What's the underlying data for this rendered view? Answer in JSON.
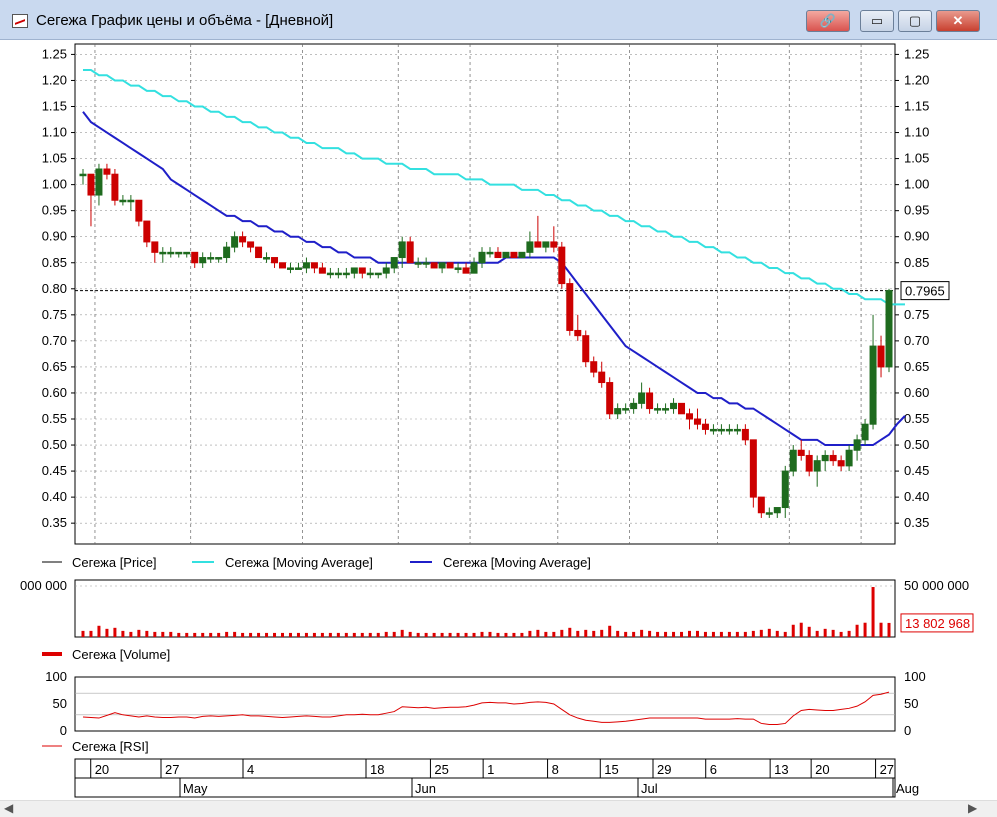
{
  "window": {
    "title": "Сегежа График цены и объёма - [Дневной]",
    "buttons": {
      "minimize": "▭",
      "maximize": "▢",
      "close": "✕",
      "link": "🔗"
    }
  },
  "colors": {
    "up_candle": "#1e6b1e",
    "down_candle": "#cc0000",
    "ma_long": "#33e0e0",
    "ma_short": "#1f1fc8",
    "volume": "#dd0000",
    "rsi": "#dd0000"
  },
  "legend": {
    "price": "Сегежа [Price]",
    "ma_long": "Сегежа [Moving Average]",
    "ma_short": "Сегежа [Moving Average]",
    "volume": "Сегежа [Volume]",
    "rsi": "Сегежа [RSI]"
  },
  "chart_data": [
    {
      "type": "candlestick",
      "name": "price",
      "ylim": [
        0.31,
        1.27
      ],
      "yticks": [
        "1.25",
        "1.20",
        "1.15",
        "1.10",
        "1.05",
        "1.00",
        "0.95",
        "0.90",
        "0.85",
        "0.80",
        "0.75",
        "0.70",
        "0.65",
        "0.60",
        "0.55",
        "0.50",
        "0.45",
        "0.40",
        "0.35"
      ],
      "last_price_label": "0.7965",
      "last_price": 0.7965,
      "grid": true,
      "candles": [
        [
          1.02,
          1.03,
          1.0,
          1.02
        ],
        [
          1.02,
          1.0,
          0.92,
          0.98
        ],
        [
          0.98,
          1.04,
          0.96,
          1.03
        ],
        [
          1.03,
          1.04,
          1.01,
          1.02
        ],
        [
          1.02,
          1.03,
          0.96,
          0.97
        ],
        [
          0.97,
          0.98,
          0.96,
          0.97
        ],
        [
          0.97,
          0.98,
          0.95,
          0.97
        ],
        [
          0.97,
          0.97,
          0.92,
          0.93
        ],
        [
          0.93,
          0.93,
          0.88,
          0.89
        ],
        [
          0.89,
          0.88,
          0.85,
          0.87
        ],
        [
          0.87,
          0.88,
          0.85,
          0.87
        ],
        [
          0.87,
          0.88,
          0.86,
          0.87
        ],
        [
          0.87,
          0.87,
          0.86,
          0.87
        ],
        [
          0.87,
          0.87,
          0.86,
          0.87
        ],
        [
          0.87,
          0.87,
          0.84,
          0.85
        ],
        [
          0.85,
          0.87,
          0.84,
          0.86
        ],
        [
          0.86,
          0.87,
          0.85,
          0.86
        ],
        [
          0.86,
          0.86,
          0.85,
          0.86
        ],
        [
          0.86,
          0.89,
          0.85,
          0.88
        ],
        [
          0.88,
          0.91,
          0.87,
          0.9
        ],
        [
          0.9,
          0.91,
          0.88,
          0.89
        ],
        [
          0.89,
          0.89,
          0.87,
          0.88
        ],
        [
          0.88,
          0.88,
          0.86,
          0.86
        ],
        [
          0.86,
          0.87,
          0.85,
          0.86
        ],
        [
          0.86,
          0.86,
          0.84,
          0.85
        ],
        [
          0.85,
          0.85,
          0.84,
          0.84
        ],
        [
          0.84,
          0.85,
          0.83,
          0.84
        ],
        [
          0.84,
          0.85,
          0.84,
          0.84
        ],
        [
          0.84,
          0.86,
          0.83,
          0.85
        ],
        [
          0.85,
          0.85,
          0.83,
          0.84
        ],
        [
          0.84,
          0.85,
          0.83,
          0.83
        ],
        [
          0.83,
          0.84,
          0.82,
          0.83
        ],
        [
          0.83,
          0.84,
          0.82,
          0.83
        ],
        [
          0.83,
          0.84,
          0.82,
          0.83
        ],
        [
          0.83,
          0.84,
          0.82,
          0.84
        ],
        [
          0.84,
          0.84,
          0.82,
          0.83
        ],
        [
          0.83,
          0.84,
          0.82,
          0.83
        ],
        [
          0.83,
          0.83,
          0.82,
          0.83
        ],
        [
          0.83,
          0.85,
          0.82,
          0.84
        ],
        [
          0.84,
          0.86,
          0.83,
          0.86
        ],
        [
          0.86,
          0.9,
          0.84,
          0.89
        ],
        [
          0.89,
          0.9,
          0.85,
          0.85
        ],
        [
          0.85,
          0.86,
          0.84,
          0.85
        ],
        [
          0.85,
          0.86,
          0.84,
          0.85
        ],
        [
          0.85,
          0.85,
          0.84,
          0.84
        ],
        [
          0.84,
          0.85,
          0.83,
          0.85
        ],
        [
          0.85,
          0.85,
          0.84,
          0.84
        ],
        [
          0.84,
          0.85,
          0.83,
          0.84
        ],
        [
          0.84,
          0.85,
          0.83,
          0.83
        ],
        [
          0.83,
          0.86,
          0.83,
          0.85
        ],
        [
          0.85,
          0.88,
          0.84,
          0.87
        ],
        [
          0.87,
          0.88,
          0.86,
          0.87
        ],
        [
          0.87,
          0.88,
          0.86,
          0.86
        ],
        [
          0.86,
          0.87,
          0.86,
          0.87
        ],
        [
          0.87,
          0.87,
          0.86,
          0.86
        ],
        [
          0.86,
          0.87,
          0.86,
          0.87
        ],
        [
          0.87,
          0.91,
          0.86,
          0.89
        ],
        [
          0.89,
          0.94,
          0.88,
          0.88
        ],
        [
          0.88,
          0.89,
          0.87,
          0.89
        ],
        [
          0.89,
          0.92,
          0.87,
          0.88
        ],
        [
          0.88,
          0.89,
          0.8,
          0.81
        ],
        [
          0.81,
          0.82,
          0.71,
          0.72
        ],
        [
          0.72,
          0.75,
          0.7,
          0.71
        ],
        [
          0.71,
          0.72,
          0.65,
          0.66
        ],
        [
          0.66,
          0.67,
          0.63,
          0.64
        ],
        [
          0.64,
          0.66,
          0.61,
          0.62
        ],
        [
          0.62,
          0.63,
          0.55,
          0.56
        ],
        [
          0.56,
          0.58,
          0.55,
          0.57
        ],
        [
          0.57,
          0.58,
          0.56,
          0.57
        ],
        [
          0.57,
          0.59,
          0.56,
          0.58
        ],
        [
          0.58,
          0.62,
          0.57,
          0.6
        ],
        [
          0.6,
          0.61,
          0.56,
          0.57
        ],
        [
          0.57,
          0.58,
          0.56,
          0.57
        ],
        [
          0.57,
          0.58,
          0.56,
          0.57
        ],
        [
          0.57,
          0.59,
          0.56,
          0.58
        ],
        [
          0.58,
          0.58,
          0.56,
          0.56
        ],
        [
          0.56,
          0.57,
          0.53,
          0.55
        ],
        [
          0.55,
          0.57,
          0.53,
          0.54
        ],
        [
          0.54,
          0.55,
          0.52,
          0.53
        ],
        [
          0.53,
          0.54,
          0.52,
          0.53
        ],
        [
          0.53,
          0.54,
          0.52,
          0.53
        ],
        [
          0.53,
          0.54,
          0.52,
          0.53
        ],
        [
          0.53,
          0.54,
          0.52,
          0.53
        ],
        [
          0.53,
          0.54,
          0.5,
          0.51
        ],
        [
          0.51,
          0.51,
          0.38,
          0.4
        ],
        [
          0.4,
          0.4,
          0.36,
          0.37
        ],
        [
          0.37,
          0.38,
          0.36,
          0.37
        ],
        [
          0.37,
          0.38,
          0.36,
          0.38
        ],
        [
          0.38,
          0.46,
          0.36,
          0.45
        ],
        [
          0.45,
          0.5,
          0.44,
          0.49
        ],
        [
          0.49,
          0.51,
          0.47,
          0.48
        ],
        [
          0.48,
          0.49,
          0.44,
          0.45
        ],
        [
          0.45,
          0.48,
          0.42,
          0.47
        ],
        [
          0.47,
          0.49,
          0.45,
          0.48
        ],
        [
          0.48,
          0.49,
          0.46,
          0.47
        ],
        [
          0.47,
          0.48,
          0.45,
          0.46
        ],
        [
          0.46,
          0.5,
          0.45,
          0.49
        ],
        [
          0.49,
          0.52,
          0.47,
          0.51
        ],
        [
          0.51,
          0.55,
          0.5,
          0.54
        ],
        [
          0.54,
          0.75,
          0.53,
          0.69
        ],
        [
          0.69,
          0.71,
          0.63,
          0.65
        ],
        [
          0.65,
          0.8,
          0.64,
          0.7965
        ]
      ],
      "ma_long": [
        1.22,
        1.22,
        1.21,
        1.21,
        1.2,
        1.2,
        1.19,
        1.19,
        1.18,
        1.18,
        1.17,
        1.17,
        1.16,
        1.16,
        1.15,
        1.15,
        1.14,
        1.14,
        1.13,
        1.13,
        1.12,
        1.12,
        1.11,
        1.11,
        1.1,
        1.1,
        1.09,
        1.09,
        1.08,
        1.08,
        1.07,
        1.07,
        1.07,
        1.06,
        1.06,
        1.05,
        1.05,
        1.05,
        1.04,
        1.04,
        1.04,
        1.03,
        1.03,
        1.03,
        1.02,
        1.02,
        1.02,
        1.02,
        1.01,
        1.01,
        1.01,
        1.0,
        1.0,
        1.0,
        1.0,
        0.99,
        0.99,
        0.99,
        0.98,
        0.98,
        0.97,
        0.97,
        0.96,
        0.96,
        0.95,
        0.95,
        0.94,
        0.94,
        0.93,
        0.93,
        0.92,
        0.92,
        0.91,
        0.91,
        0.9,
        0.9,
        0.89,
        0.89,
        0.88,
        0.88,
        0.87,
        0.87,
        0.86,
        0.86,
        0.85,
        0.85,
        0.84,
        0.84,
        0.83,
        0.83,
        0.82,
        0.82,
        0.81,
        0.81,
        0.8,
        0.8,
        0.79,
        0.79,
        0.78,
        0.78,
        0.78,
        0.77,
        0.77,
        0.77
      ],
      "ma_short": [
        1.14,
        1.12,
        1.11,
        1.1,
        1.09,
        1.08,
        1.07,
        1.06,
        1.05,
        1.04,
        1.03,
        1.01,
        1.0,
        0.99,
        0.98,
        0.97,
        0.96,
        0.95,
        0.94,
        0.94,
        0.93,
        0.93,
        0.92,
        0.92,
        0.91,
        0.91,
        0.9,
        0.9,
        0.89,
        0.89,
        0.88,
        0.88,
        0.87,
        0.87,
        0.86,
        0.86,
        0.86,
        0.85,
        0.85,
        0.85,
        0.85,
        0.85,
        0.85,
        0.85,
        0.85,
        0.85,
        0.85,
        0.85,
        0.85,
        0.85,
        0.85,
        0.85,
        0.85,
        0.86,
        0.86,
        0.86,
        0.86,
        0.86,
        0.86,
        0.86,
        0.85,
        0.83,
        0.81,
        0.79,
        0.77,
        0.75,
        0.73,
        0.71,
        0.69,
        0.68,
        0.67,
        0.66,
        0.65,
        0.64,
        0.63,
        0.62,
        0.61,
        0.6,
        0.6,
        0.59,
        0.59,
        0.58,
        0.58,
        0.57,
        0.57,
        0.56,
        0.55,
        0.54,
        0.53,
        0.52,
        0.51,
        0.51,
        0.51,
        0.5,
        0.5,
        0.5,
        0.5,
        0.5,
        0.5,
        0.5,
        0.51,
        0.52,
        0.54,
        0.556
      ]
    },
    {
      "type": "bar",
      "name": "volume",
      "ylim": [
        0,
        50000000
      ],
      "yticks_left": [
        "000 000"
      ],
      "yticks_right": [
        "50 000 000"
      ],
      "last_value_label": "13 802 968",
      "last_value": 13802968,
      "values": [
        6000000,
        6000000,
        11000000,
        8000000,
        9000000,
        6000000,
        5000000,
        7000000,
        6000000,
        5000000,
        5000000,
        5000000,
        4000000,
        4000000,
        4000000,
        4000000,
        4000000,
        4000000,
        5000000,
        5000000,
        4000000,
        4000000,
        4000000,
        4000000,
        4000000,
        4000000,
        4000000,
        4000000,
        4000000,
        4000000,
        4000000,
        4000000,
        4000000,
        4000000,
        4000000,
        4000000,
        4000000,
        4000000,
        5000000,
        5000000,
        7000000,
        5000000,
        4000000,
        4000000,
        4000000,
        4000000,
        4000000,
        4000000,
        4000000,
        4000000,
        5000000,
        5000000,
        4000000,
        4000000,
        4000000,
        4000000,
        6000000,
        7000000,
        5000000,
        5000000,
        7000000,
        9000000,
        6000000,
        7000000,
        6000000,
        7000000,
        11000000,
        6000000,
        5000000,
        5000000,
        7000000,
        6000000,
        5000000,
        5000000,
        5000000,
        5000000,
        6000000,
        6000000,
        5000000,
        5000000,
        5000000,
        5000000,
        5000000,
        5000000,
        6000000,
        7000000,
        8000000,
        6000000,
        5000000,
        12000000,
        14000000,
        10000000,
        6000000,
        8000000,
        7000000,
        5000000,
        6000000,
        12000000,
        14000000,
        49000000,
        14000000,
        13802968
      ]
    },
    {
      "type": "line",
      "name": "rsi",
      "ylim": [
        0,
        100
      ],
      "yticks": [
        "100",
        "50",
        "0"
      ],
      "values": [
        26,
        25,
        24,
        29,
        34,
        30,
        28,
        26,
        28,
        26,
        25,
        25,
        26,
        26,
        24,
        27,
        28,
        27,
        28,
        29,
        30,
        28,
        28,
        27,
        26,
        25,
        26,
        27,
        28,
        27,
        26,
        26,
        28,
        30,
        30,
        31,
        30,
        30,
        33,
        36,
        45,
        44,
        43,
        44,
        42,
        43,
        44,
        44,
        45,
        48,
        52,
        53,
        52,
        52,
        50,
        51,
        53,
        54,
        53,
        50,
        40,
        30,
        24,
        20,
        18,
        16,
        16,
        17,
        18,
        20,
        22,
        24,
        24,
        24,
        24,
        24,
        24,
        24,
        22,
        22,
        22,
        22,
        23,
        22,
        22,
        14,
        12,
        12,
        14,
        28,
        38,
        40,
        39,
        38,
        38,
        40,
        42,
        46,
        54,
        66,
        68,
        72
      ]
    }
  ],
  "xaxis": {
    "day_labels": [
      "20",
      "27",
      "4",
      "18",
      "25",
      "1",
      "8",
      "15",
      "29",
      "6",
      "13",
      "20",
      "27"
    ],
    "month_labels": [
      "May",
      "Jun",
      "Jul",
      "Aug"
    ]
  }
}
